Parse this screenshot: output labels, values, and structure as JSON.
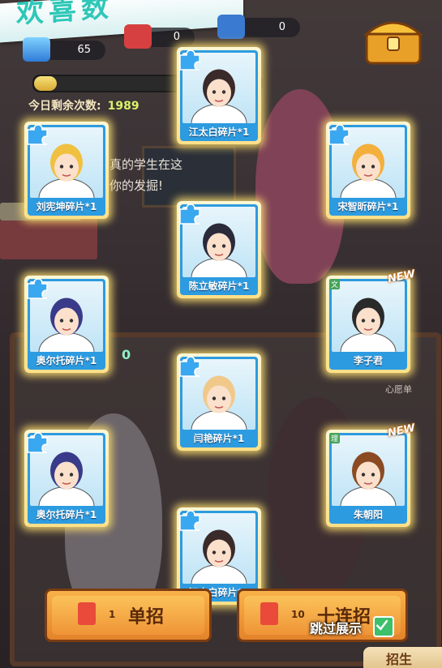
{
  "header": {
    "title": "欢喜数",
    "resources": [
      {
        "name": "gem",
        "value": "65"
      },
      {
        "name": "recruit-ticket-red",
        "value": "0"
      },
      {
        "name": "recruit-ticket-blue",
        "value": "0"
      }
    ],
    "progress": 0.1
  },
  "remaining": {
    "label": "今日剩余次数:",
    "value": "1989"
  },
  "background": {
    "dialog_lines": [
      "真的学生在这",
      "你的发掘!"
    ],
    "zero_badge": "0",
    "wish_label": "心愿单"
  },
  "cards": [
    {
      "label": "江太白碎片*1",
      "kind": "fragment",
      "is_new": false
    },
    {
      "label": "刘宪坤碎片*1",
      "kind": "fragment",
      "is_new": false
    },
    {
      "label": "宋智昕碎片*1",
      "kind": "fragment",
      "is_new": false
    },
    {
      "label": "陈立敏碎片*1",
      "kind": "fragment",
      "is_new": false
    },
    {
      "label": "奥尔托碎片*1",
      "kind": "fragment",
      "is_new": false
    },
    {
      "label": "李子君",
      "kind": "character",
      "is_new": true,
      "badge": "文",
      "new_text": "NEW"
    },
    {
      "label": "闫艳碎片*1",
      "kind": "fragment",
      "is_new": false
    },
    {
      "label": "奥尔托碎片*1",
      "kind": "fragment",
      "is_new": false
    },
    {
      "label": "朱朝阳",
      "kind": "character",
      "is_new": true,
      "badge": "理",
      "new_text": "NEW"
    },
    {
      "label": "江太白碎片*1",
      "kind": "fragment",
      "is_new": false
    }
  ],
  "actions": {
    "single": {
      "count": "1",
      "label": "单招"
    },
    "ten": {
      "count": "10",
      "label": "十连招"
    },
    "skip_label": "跳过展示",
    "skip_checked": true,
    "corner_tab": "招生"
  },
  "colors": {
    "card_blue": "#2d9be0",
    "card_glow": "#ffe06e",
    "button_orange": "#ef9436"
  }
}
